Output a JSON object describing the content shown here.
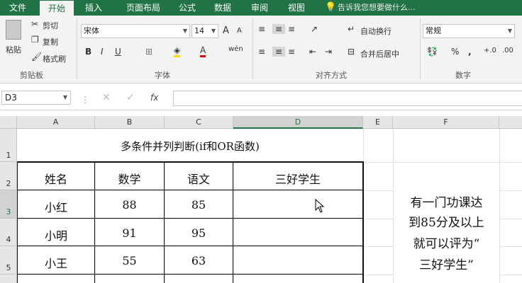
{
  "tabs": [
    "文件",
    "开始",
    "插入",
    "页面布局",
    "公式",
    "数据",
    "审阅",
    "视图"
  ],
  "tell_me": "告诉我您想要做什么...",
  "ribbon": {
    "clipboard": {
      "paste": "粘贴",
      "cut": "剪切",
      "copy": "复制",
      "format_painter": "格式刷",
      "group": "剪贴板"
    },
    "font": {
      "name": "宋体",
      "size": "14",
      "bold": "B",
      "italic": "I",
      "underline": "U",
      "group": "字体",
      "grow": "A",
      "shrink": "A"
    },
    "alignment": {
      "wrap": "自动换行",
      "merge": "合并后居中",
      "group": "对齐方式"
    },
    "number": {
      "format": "常规",
      "percent": "%",
      "comma": ",",
      "group": "数字"
    }
  },
  "formula_bar": {
    "cell_ref": "D3",
    "fx": "fx",
    "content": ""
  },
  "columns": [
    "A",
    "B",
    "C",
    "D",
    "E",
    "F"
  ],
  "rows": [
    "1",
    "2",
    "3",
    "4",
    "5"
  ],
  "sheet": {
    "title": "多条件并列判断(if和OR函数)",
    "headers": [
      "姓名",
      "数学",
      "语文",
      "三好学生"
    ],
    "data": [
      [
        "小红",
        "88",
        "85",
        ""
      ],
      [
        "小明",
        "91",
        "95",
        ""
      ],
      [
        "小王",
        "55",
        "63",
        ""
      ]
    ],
    "note_lines": [
      "有一门功课达",
      "到85分及以上",
      "就可以评为“",
      "三好学生”"
    ]
  },
  "colors": {
    "brand": "#217346",
    "ribbon_bg": "#f3f3f3",
    "grid": "#e1e1e1"
  }
}
